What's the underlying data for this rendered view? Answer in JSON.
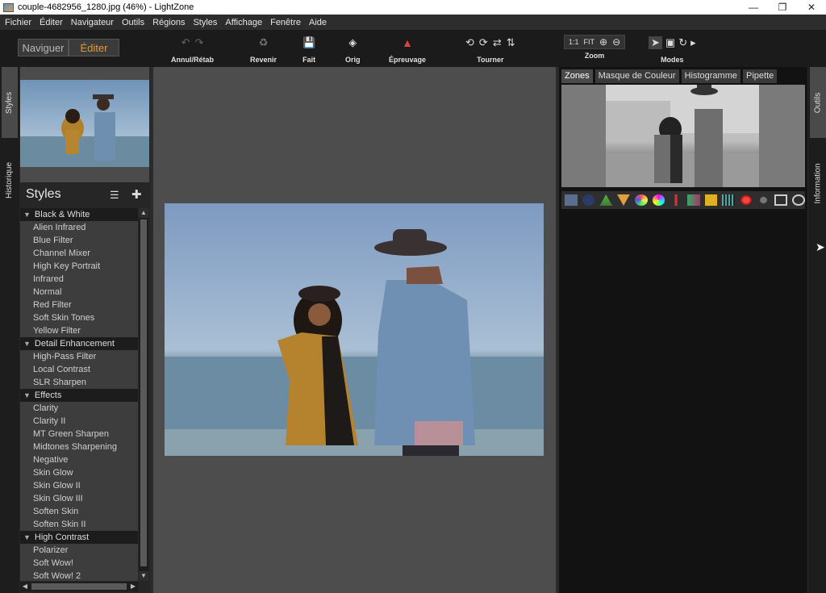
{
  "window": {
    "title": "couple-4682956_1280.jpg (46%) - LightZone",
    "minimize": "—",
    "restore": "❐",
    "close": "✕"
  },
  "menu": [
    "Fichier",
    "Éditer",
    "Navigateur",
    "Outils",
    "Régions",
    "Styles",
    "Affichage",
    "Fenêtre",
    "Aide"
  ],
  "mode": {
    "browse": "Naviguer",
    "edit": "Éditer"
  },
  "toolbar": {
    "undo_redo": "Annul/Rétab",
    "revert": "Revenir",
    "done": "Fait",
    "orig": "Orig",
    "proof": "Épreuvage",
    "rotate": "Tourner",
    "zoom": "Zoom",
    "zoom_1to1": "1:1",
    "zoom_fit": "FIT",
    "modes": "Modes"
  },
  "left_tabs": {
    "styles": "Styles",
    "history": "Historique"
  },
  "styles_panel": {
    "title": "Styles",
    "items": [
      {
        "type": "category",
        "label": "Black & White"
      },
      {
        "type": "item",
        "label": "Alien Infrared"
      },
      {
        "type": "item",
        "label": "Blue Filter"
      },
      {
        "type": "item",
        "label": "Channel Mixer"
      },
      {
        "type": "item",
        "label": "High Key Portrait"
      },
      {
        "type": "item",
        "label": "Infrared"
      },
      {
        "type": "item",
        "label": "Normal"
      },
      {
        "type": "item",
        "label": "Red Filter"
      },
      {
        "type": "item",
        "label": "Soft Skin Tones"
      },
      {
        "type": "item",
        "label": "Yellow Filter"
      },
      {
        "type": "category",
        "label": "Detail Enhancement"
      },
      {
        "type": "item",
        "label": "High-Pass Filter"
      },
      {
        "type": "item",
        "label": "Local Contrast"
      },
      {
        "type": "item",
        "label": "SLR Sharpen"
      },
      {
        "type": "category",
        "label": "Effects"
      },
      {
        "type": "item",
        "label": "Clarity"
      },
      {
        "type": "item",
        "label": "Clarity II"
      },
      {
        "type": "item",
        "label": "MT Green Sharpen"
      },
      {
        "type": "item",
        "label": "Midtones Sharpening"
      },
      {
        "type": "item",
        "label": "Negative"
      },
      {
        "type": "item",
        "label": "Skin Glow"
      },
      {
        "type": "item",
        "label": "Skin Glow II"
      },
      {
        "type": "item",
        "label": "Skin Glow III"
      },
      {
        "type": "item",
        "label": "Soften Skin"
      },
      {
        "type": "item",
        "label": "Soften Skin II"
      },
      {
        "type": "category",
        "label": "High Contrast"
      },
      {
        "type": "item",
        "label": "Polarizer"
      },
      {
        "type": "item",
        "label": "Soft Wow!"
      },
      {
        "type": "item",
        "label": "Soft Wow! 2"
      }
    ]
  },
  "right_tabs": [
    "Zones",
    "Masque de Couleur",
    "Histogramme",
    "Pipette"
  ],
  "right_strip": {
    "tools": "Outils",
    "info": "Information"
  },
  "colors": {
    "accent": "#e69a2e"
  }
}
